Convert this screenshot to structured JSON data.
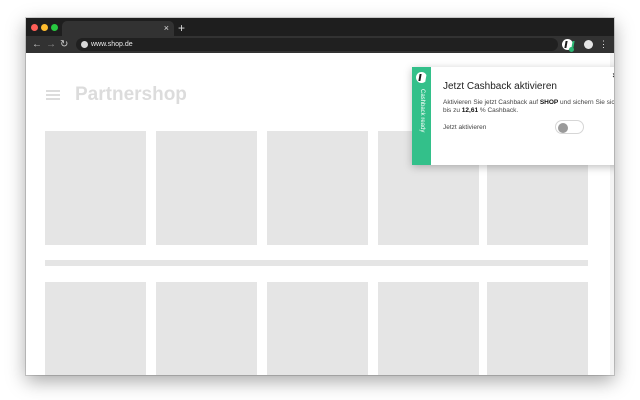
{
  "browser": {
    "tab_close": "×",
    "new_tab": "+",
    "nav": {
      "back": "←",
      "forward": "→",
      "reload": "↻"
    },
    "url": "www.shop.de",
    "menu": "⋮",
    "icons": [
      "globe-icon",
      "extension-icon",
      "profile-icon",
      "menu-icon",
      "close-icon",
      "plus-icon"
    ]
  },
  "page": {
    "title": "Partnershop",
    "hamburger_icon": "hamburger-icon"
  },
  "popup": {
    "side_label": "Cashback ready",
    "close": "×",
    "title": "Jetzt Cashback aktivieren",
    "body_prefix": "Aktivieren Sie jetzt Cashback auf ",
    "shop_name": "SHOP",
    "body_middle": " und sichern Sie sich bis zu ",
    "rate": "12,61",
    "body_suffix": " % Cashback.",
    "toggle_label": "Jetzt aktivieren",
    "toggle_on": false,
    "accent_color": "#33c08a"
  },
  "colors": {
    "chrome_dark": "#1e1e1e",
    "toolbar": "#323232",
    "placeholder_gray": "#e5e5e5"
  }
}
